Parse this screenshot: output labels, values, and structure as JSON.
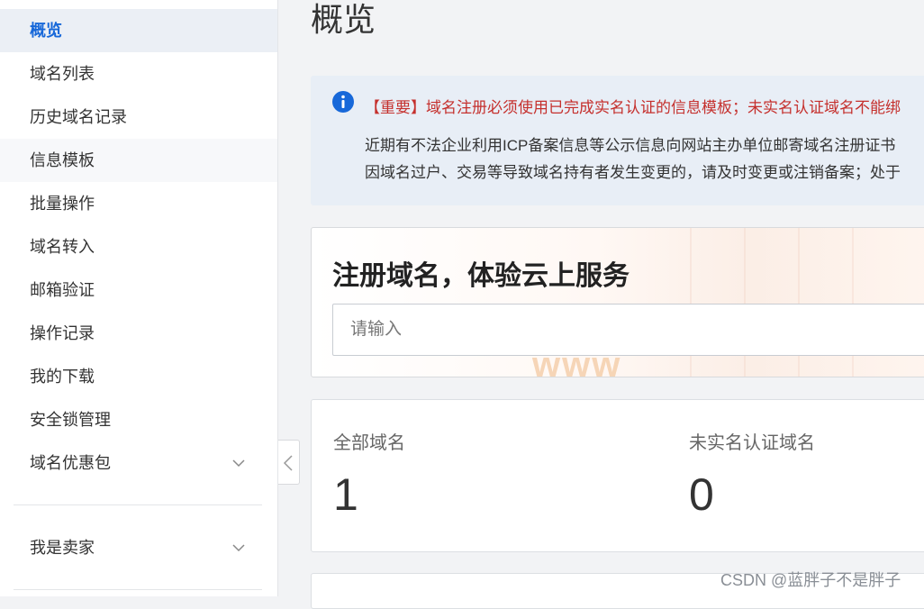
{
  "sidebar": {
    "items": [
      {
        "label": "概览"
      },
      {
        "label": "域名列表"
      },
      {
        "label": "历史域名记录"
      },
      {
        "label": "信息模板"
      },
      {
        "label": "批量操作"
      },
      {
        "label": "域名转入"
      },
      {
        "label": "邮箱验证"
      },
      {
        "label": "操作记录"
      },
      {
        "label": "我的下载"
      },
      {
        "label": "安全锁管理"
      },
      {
        "label": "域名优惠包"
      }
    ],
    "seller": {
      "label": "我是卖家"
    }
  },
  "main": {
    "title": "概览",
    "notice": {
      "line1": "【重要】域名注册必须使用已完成实名认证的信息模板；未实名认证域名不能绑",
      "line2": "近期有不法企业利用ICP备案信息等公示信息向网站主办单位邮寄域名注册证书",
      "line3": "因域名过户、交易等导致域名持有者发生变更的，请及时变更或注销备案；处于"
    },
    "register": {
      "title": "注册域名，体验云上服务",
      "placeholder": "请输入",
      "bg_text": "www"
    },
    "stats": [
      {
        "label": "全部域名",
        "value": "1"
      },
      {
        "label": "未实名认证域名",
        "value": "0"
      }
    ]
  },
  "watermark": "CSDN @蓝胖子不是胖子",
  "colors": {
    "accent": "#1768d9",
    "notice_red": "#c5302d",
    "notice_bg": "#e8eef6"
  }
}
